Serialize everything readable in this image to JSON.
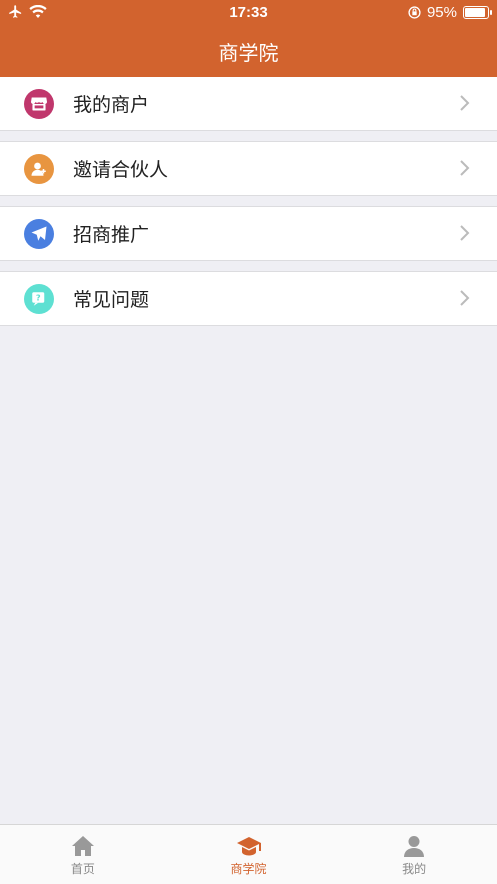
{
  "status_bar": {
    "time": "17:33",
    "battery_percent": "95%",
    "battery_level": 0.95
  },
  "navbar": {
    "title": "商学院"
  },
  "menu": {
    "items": [
      {
        "label": "我的商户",
        "icon": "store-icon",
        "color": "#c0376c"
      },
      {
        "label": "邀请合伙人",
        "icon": "invite-partner-icon",
        "color": "#e89540"
      },
      {
        "label": "招商推广",
        "icon": "paper-plane-icon",
        "color": "#4a7fe0"
      },
      {
        "label": "常见问题",
        "icon": "faq-icon",
        "color": "#5ee0d2"
      }
    ]
  },
  "tabbar": {
    "active_color": "#d2632e",
    "tabs": [
      {
        "label": "首页",
        "icon": "home-icon",
        "active": false
      },
      {
        "label": "商学院",
        "icon": "graduation-cap-icon",
        "active": true
      },
      {
        "label": "我的",
        "icon": "user-icon",
        "active": false
      }
    ]
  },
  "colors": {
    "brand": "#d2632e",
    "background": "#efeff4"
  }
}
